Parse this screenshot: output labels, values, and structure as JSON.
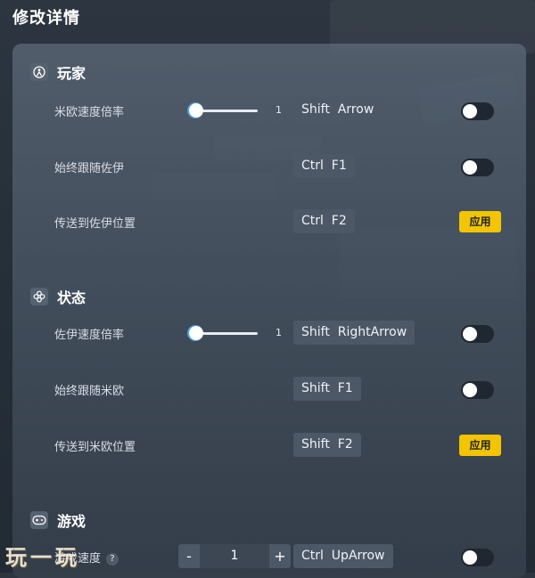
{
  "page": {
    "title": "修改详情"
  },
  "sections": [
    {
      "title": "玩家",
      "icon": "person-icon",
      "rows": [
        {
          "label": "米欧速度倍率",
          "slider_value": "1",
          "hotkey": "Shift  Arrow",
          "toggle_on": false
        },
        {
          "label": "始终跟随佐伊",
          "hotkey": "Ctrl  F1",
          "toggle_on": false
        },
        {
          "label": "传送到佐伊位置",
          "hotkey": "Ctrl  F2",
          "action": "应用"
        }
      ]
    },
    {
      "title": "状态",
      "icon": "status-icon",
      "rows": [
        {
          "label": "佐伊速度倍率",
          "slider_value": "1",
          "hotkey": "Shift  RightArrow",
          "toggle_on": false
        },
        {
          "label": "始终跟随米欧",
          "hotkey": "Shift  F1",
          "toggle_on": false
        },
        {
          "label": "传送到米欧位置",
          "hotkey": "Shift  F2",
          "action": "应用"
        }
      ]
    },
    {
      "title": "游戏",
      "icon": "gamepad-icon",
      "rows": [
        {
          "label": "游戏速度",
          "help": "?",
          "stepper": {
            "minus": "-",
            "value": "1",
            "plus": "+"
          },
          "hotkey": "Ctrl  UpArrow",
          "toggle_on": false
        }
      ]
    }
  ],
  "watermark": "玩一玩",
  "colors": {
    "accent_yellow": "#f2c500",
    "slider_accent": "#4aa0e0",
    "panel": "#4e5a68"
  }
}
